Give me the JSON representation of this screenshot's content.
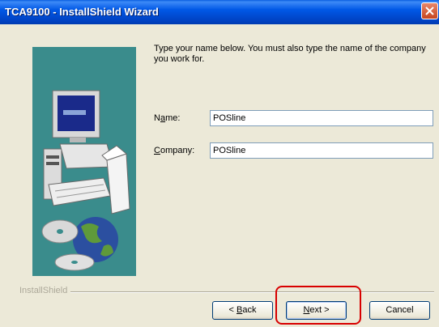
{
  "window": {
    "title": "TCA9100 - InstallShield Wizard"
  },
  "prompt": "Type your name below. You must also type the name of the company you work for.",
  "fields": {
    "name": {
      "label_pre": "N",
      "label_key": "a",
      "label_post": "me:",
      "value": "POSline"
    },
    "company": {
      "label_pre": "",
      "label_key": "C",
      "label_post": "ompany:",
      "value": "POSline"
    }
  },
  "footer": {
    "brand": "InstallShield"
  },
  "buttons": {
    "back": {
      "key": "B",
      "rest": "ack",
      "pre": "< "
    },
    "next": {
      "key": "N",
      "rest": "ext >"
    },
    "cancel": {
      "label": "Cancel"
    }
  },
  "colors": {
    "panel": "#3a8c8c",
    "highlight": "#d80000",
    "title_bar": "#0058e6"
  }
}
